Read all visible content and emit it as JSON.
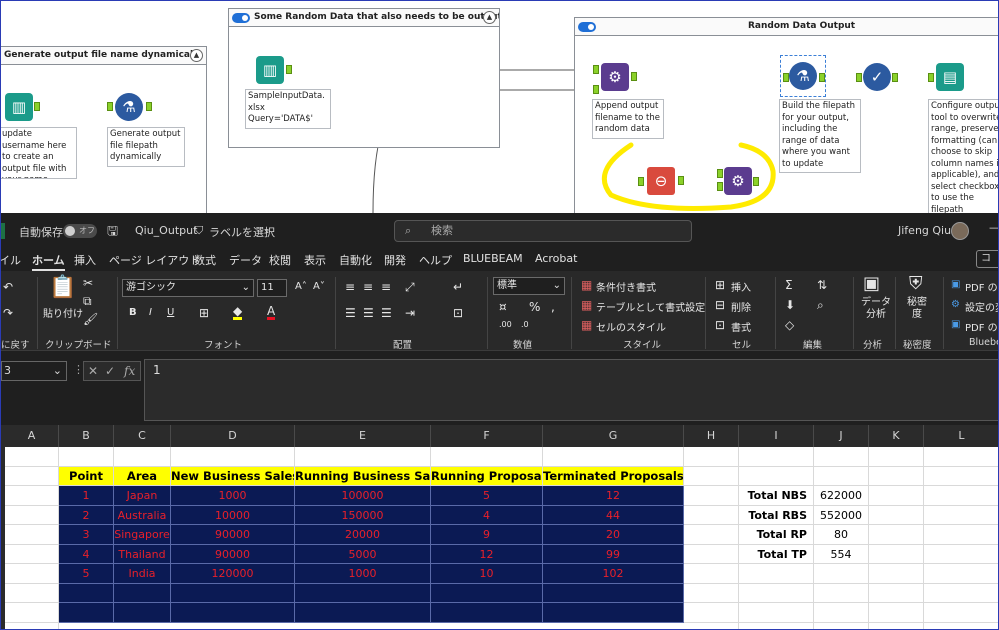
{
  "alteryx": {
    "container1": {
      "title": "Generate output file name dynamically",
      "anno_update": "update username here to create an output file with your name.",
      "anno_formula": "Generate output file filepath dynamically"
    },
    "container2": {
      "title": "Some Random Data that also needs to be output",
      "anno_input": "SampleInputData.xlsx\nQuery='DATA$'"
    },
    "container3": {
      "title": "Random Data Output",
      "anno_append": "Append output filename to the random data",
      "anno_build": "Build the filepath for your output, including the range of data where you want to update",
      "anno_configure": "Configure output tool to overwrite range, preserve formatting (can choose to skip column names if applicable), and select checkbox to use the filepath"
    },
    "highlight_color": "#ffeb00"
  },
  "excel": {
    "titlebar": {
      "autosave": "自動保存",
      "autosave_state": "オフ",
      "filename": "Qiu_Output",
      "label": "ラベルを選択",
      "search": "検索",
      "user": "Jifeng Qiu"
    },
    "tabs": [
      "イル",
      "ホーム",
      "挿入",
      "ページ レイアウト",
      "数式",
      "データ",
      "校閲",
      "表示",
      "自動化",
      "開発",
      "ヘルプ",
      "BLUEBEAM",
      "Acrobat"
    ],
    "share": "コ",
    "ribbon": {
      "undo_label": "に戻す",
      "clipboard_label": "クリップボード",
      "paste": "貼り付け",
      "font_name": "游ゴシック",
      "font_size": "11",
      "font_label": "フォント",
      "align_label": "配置",
      "number_format": "標準",
      "number_label": "数値",
      "cond_format": "条件付き書式",
      "table_format": "テーブルとして書式設定",
      "cell_style": "セルのスタイル",
      "style_label": "スタイル",
      "insert": "挿入",
      "delete": "削除",
      "format": "書式",
      "cell_label": "セル",
      "edit_label": "編集",
      "analyze": "データ\n分析",
      "analyze_label": "分析",
      "sensitivity": "秘密\n度",
      "sensitivity_label": "秘密度",
      "pdf1": "PDF の作",
      "pdf2": "設定の変",
      "pdf3": "PDF のバ",
      "bluebeam_label": "Bluebe"
    },
    "namebox": "3",
    "formula": "1",
    "columns": [
      "A",
      "B",
      "C",
      "D",
      "E",
      "F",
      "G",
      "H",
      "I",
      "J",
      "K",
      "L"
    ],
    "table": {
      "headers": [
        "Point",
        "Area",
        "New Business Sales",
        "Running Business Sales",
        "Running Proposals",
        "Terminated Proposals"
      ],
      "rows": [
        [
          "1",
          "Japan",
          "1000",
          "100000",
          "5",
          "12"
        ],
        [
          "2",
          "Australia",
          "10000",
          "150000",
          "4",
          "44"
        ],
        [
          "3",
          "Singapore",
          "90000",
          "20000",
          "9",
          "20"
        ],
        [
          "4",
          "Thailand",
          "90000",
          "5000",
          "12",
          "99"
        ],
        [
          "5",
          "India",
          "120000",
          "1000",
          "10",
          "102"
        ]
      ]
    },
    "totals": [
      {
        "label": "Total NBS",
        "value": "622000"
      },
      {
        "label": "Total RBS",
        "value": "552000"
      },
      {
        "label": "Total RP",
        "value": "80"
      },
      {
        "label": "Total TP",
        "value": "554"
      }
    ],
    "colors": {
      "header_fill": "#ffff00",
      "data_fill": "#0b1a54",
      "data_text": "#e8202a"
    }
  }
}
